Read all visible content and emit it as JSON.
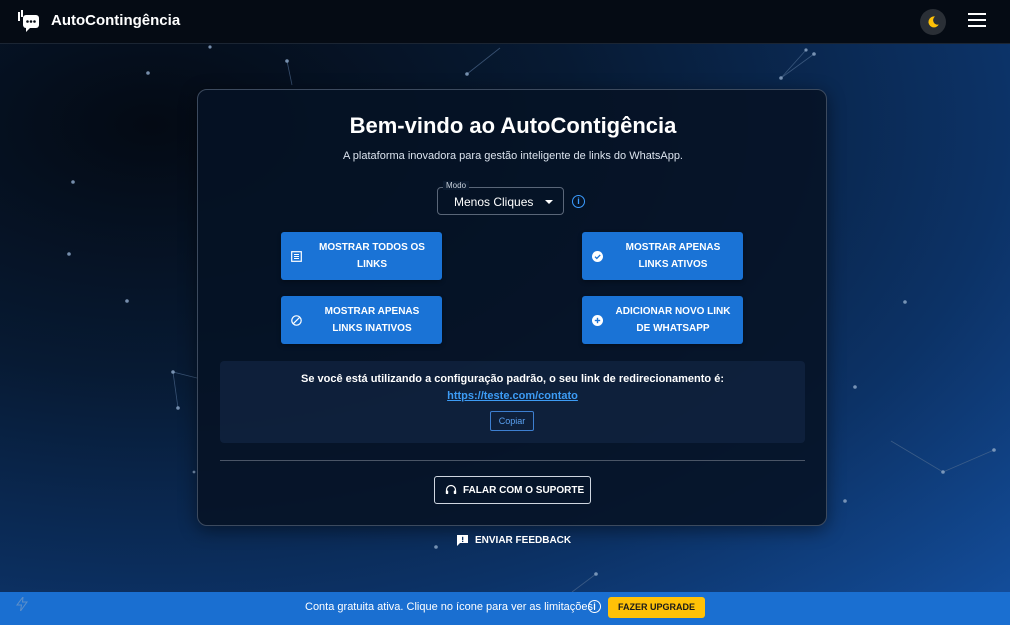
{
  "header": {
    "app_title": "AutoContingência",
    "logo_icon": "chat-logo-icon",
    "theme_icon": "moon-icon",
    "menu_icon": "hamburger-menu-icon"
  },
  "main": {
    "title": "Bem-vindo ao AutoContigência",
    "subtitle": "A plataforma inovadora para gestão inteligente de links do WhatsApp.",
    "mode_select": {
      "label": "Modo",
      "value": "Menos Cliques"
    },
    "buttons": [
      {
        "label": "MOSTRAR TODOS OS LINKS",
        "icon": "list-icon"
      },
      {
        "label": "MOSTRAR APENAS LINKS ATIVOS",
        "icon": "check-circle-icon"
      },
      {
        "label": "MOSTRAR APENAS LINKS INATIVOS",
        "icon": "block-icon"
      },
      {
        "label": "ADICIONAR NOVO LINK DE WHATSAPP",
        "icon": "add-circle-icon"
      }
    ],
    "redirect": {
      "text": "Se você está utilizando a configuração padrão, o seu link de redirecionamento é:",
      "link": "https://teste.com/contato",
      "copy_label": "Copiar"
    },
    "support_label": "FALAR COM O SUPORTE",
    "feedback_label": "ENVIAR FEEDBACK"
  },
  "footer": {
    "text": "Conta gratuita ativa. Clique no ícone para ver as limitações.",
    "upgrade_label": "FAZER UPGRADE"
  },
  "colors": {
    "primary": "#1a73d6",
    "accent_yellow": "#ffc107",
    "link": "#3d9cf5",
    "topbar": "#050b14"
  }
}
